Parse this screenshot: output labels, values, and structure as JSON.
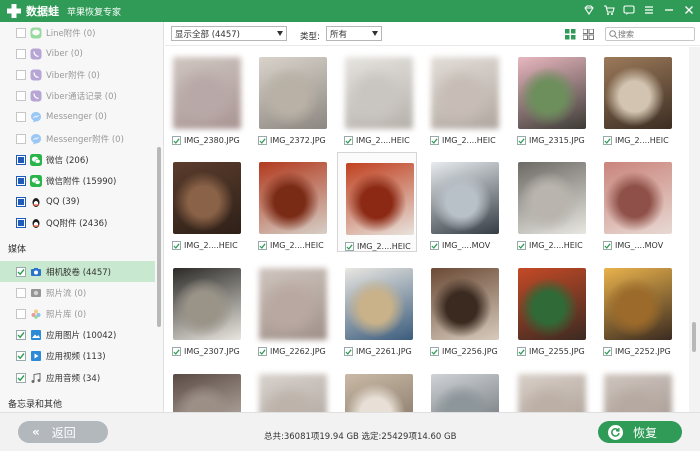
{
  "app": {
    "name": "数据蛙",
    "subtitle": "苹果恢复专家"
  },
  "sidebar": {
    "items": [
      {
        "label": "Line附件 (0)",
        "state": "unchecked",
        "grey": true,
        "icon": "line-icon",
        "color": "#3cbf4a"
      },
      {
        "label": "Viber (0)",
        "state": "unchecked",
        "grey": true,
        "icon": "viber-icon",
        "color": "#7a58b6"
      },
      {
        "label": "Viber附件 (0)",
        "state": "unchecked",
        "grey": true,
        "icon": "viber-icon",
        "color": "#7a58b6"
      },
      {
        "label": "Viber通话记录 (0)",
        "state": "unchecked",
        "grey": true,
        "icon": "viber-icon",
        "color": "#7a58b6"
      },
      {
        "label": "Messenger (0)",
        "state": "unchecked",
        "grey": true,
        "icon": "messenger-icon",
        "color": "#2a8cf0"
      },
      {
        "label": "Messenger附件 (0)",
        "state": "unchecked",
        "grey": true,
        "icon": "messenger-icon",
        "color": "#2a8cf0"
      },
      {
        "label": "微信 (206)",
        "state": "filled",
        "grey": false,
        "icon": "wechat-icon",
        "color": "#2ab54a"
      },
      {
        "label": "微信附件 (15990)",
        "state": "filled",
        "grey": false,
        "icon": "wechat-icon",
        "color": "#2ab54a"
      },
      {
        "label": "QQ (39)",
        "state": "filled",
        "grey": false,
        "icon": "qq-icon",
        "color": "#1d1d1d"
      },
      {
        "label": "QQ附件 (2436)",
        "state": "filled",
        "grey": false,
        "icon": "qq-icon",
        "color": "#1d1d1d"
      }
    ],
    "media_header": "媒体",
    "media_items": [
      {
        "label": "相机胶卷 (4457)",
        "state": "checked",
        "grey": false,
        "icon": "camera-icon",
        "color": "#2b73c8",
        "selected": true
      },
      {
        "label": "照片流 (0)",
        "state": "unchecked",
        "grey": true,
        "icon": "photostream-icon",
        "color": "#555555"
      },
      {
        "label": "照片库 (0)",
        "state": "unchecked",
        "grey": true,
        "icon": "photo-library-icon",
        "color": "#e9a23b"
      },
      {
        "label": "应用图片 (10042)",
        "state": "checked",
        "grey": false,
        "icon": "app-photos-icon",
        "color": "#2d8ad6"
      },
      {
        "label": "应用视频 (113)",
        "state": "checked",
        "grey": false,
        "icon": "app-videos-icon",
        "color": "#2d8ad6"
      },
      {
        "label": "应用音频 (34)",
        "state": "checked",
        "grey": false,
        "icon": "app-audio-icon",
        "color": "#6b6b6b"
      }
    ],
    "notes_header": "备忘录和其他"
  },
  "toolbar": {
    "show_filter": "显示全部 (4457)",
    "type_label": "类型:",
    "type_value": "所有",
    "search_placeholder": "搜索"
  },
  "grid": [
    {
      "name": "IMG_2380.JPG",
      "colors": [
        "#cfc6c0",
        "#b8a9a8",
        "#a89493"
      ],
      "blur": true
    },
    {
      "name": "IMG_2372.JPG",
      "colors": [
        "#d9d3cb",
        "#b9b1a6",
        "#8c8780"
      ],
      "blur": false
    },
    {
      "name": "IMG_2....HEIC",
      "colors": [
        "#e6e3df",
        "#c9c5c0",
        "#b5b0aa"
      ],
      "blur": true
    },
    {
      "name": "IMG_2....HEIC",
      "colors": [
        "#e3ddd8",
        "#c7bdb6",
        "#b0a69f"
      ],
      "blur": true
    },
    {
      "name": "IMG_2315.JPG",
      "colors": [
        "#e8b7bf",
        "#6d8f5c",
        "#3c3b36"
      ],
      "blur": false
    },
    {
      "name": "IMG_2....HEIC",
      "colors": [
        "#9c7a5a",
        "#d2c4b0",
        "#3b2d22"
      ],
      "blur": false
    },
    {
      "name": "IMG_2....HEIC",
      "colors": [
        "#5a3c2c",
        "#8a6247",
        "#2e2018"
      ],
      "blur": false
    },
    {
      "name": "IMG_2....HEIC",
      "colors": [
        "#b23a1e",
        "#7a2b16",
        "#d6cfc7"
      ],
      "blur": false
    },
    {
      "name": "IMG_2....HEIC",
      "colors": [
        "#c0401f",
        "#8b2914",
        "#e7e3dd"
      ],
      "blur": false,
      "selected": true
    },
    {
      "name": "IMG_....MOV",
      "colors": [
        "#e8ecef",
        "#b9c1c8",
        "#343c44"
      ],
      "blur": false
    },
    {
      "name": "IMG_2....HEIC",
      "colors": [
        "#6d6a66",
        "#b9b5ae",
        "#e8e6e1"
      ],
      "blur": false
    },
    {
      "name": "IMG_....MOV",
      "colors": [
        "#c9847b",
        "#8e5048",
        "#e8d9d3"
      ],
      "blur": false
    },
    {
      "name": "IMG_2307.JPG",
      "colors": [
        "#2c2a27",
        "#9a9488",
        "#e9e6df"
      ],
      "blur": false
    },
    {
      "name": "IMG_2262.JPG",
      "colors": [
        "#cfc5bf",
        "#b9a8a1",
        "#a09089"
      ],
      "blur": true
    },
    {
      "name": "IMG_2261.JPG",
      "colors": [
        "#e9e7e2",
        "#c9b28a",
        "#3b5c7c"
      ],
      "blur": false
    },
    {
      "name": "IMG_2256.JPG",
      "colors": [
        "#6b4a35",
        "#3a2a20",
        "#d7cbbd"
      ],
      "blur": false
    },
    {
      "name": "IMG_2255.JPG",
      "colors": [
        "#c44a26",
        "#2f6a37",
        "#3b2a22"
      ],
      "blur": false
    },
    {
      "name": "IMG_2252.JPG",
      "colors": [
        "#e9b24c",
        "#9c6a2a",
        "#3a2a20"
      ],
      "blur": false
    },
    {
      "name": "",
      "colors": [
        "#5a4a44",
        "#9b8f86",
        "#cfc7bf"
      ],
      "blur": false
    },
    {
      "name": "",
      "colors": [
        "#d8d2cd",
        "#bdb3ab",
        "#a79c94"
      ],
      "blur": true
    },
    {
      "name": "",
      "colors": [
        "#c9b9a6",
        "#e8e0d6",
        "#7a6a5a"
      ],
      "blur": false
    },
    {
      "name": "",
      "colors": [
        "#cfd3d6",
        "#8d969b",
        "#5c6268"
      ],
      "blur": false
    },
    {
      "name": "",
      "colors": [
        "#d8cfc8",
        "#bcafa6",
        "#a3968c"
      ],
      "blur": true
    },
    {
      "name": "",
      "colors": [
        "#cfc5bf",
        "#b6a9a1",
        "#9c8f87"
      ],
      "blur": true
    }
  ],
  "bottom": {
    "back_label": "返回",
    "status": "总共:36081项19.94 GB 选定:25429项14.60 GB",
    "recover_label": "恢复"
  },
  "colors": {
    "brand": "#2f9b56",
    "selected_bg": "#c8e8cf",
    "checkbox_blue": "#1e5bb8"
  }
}
